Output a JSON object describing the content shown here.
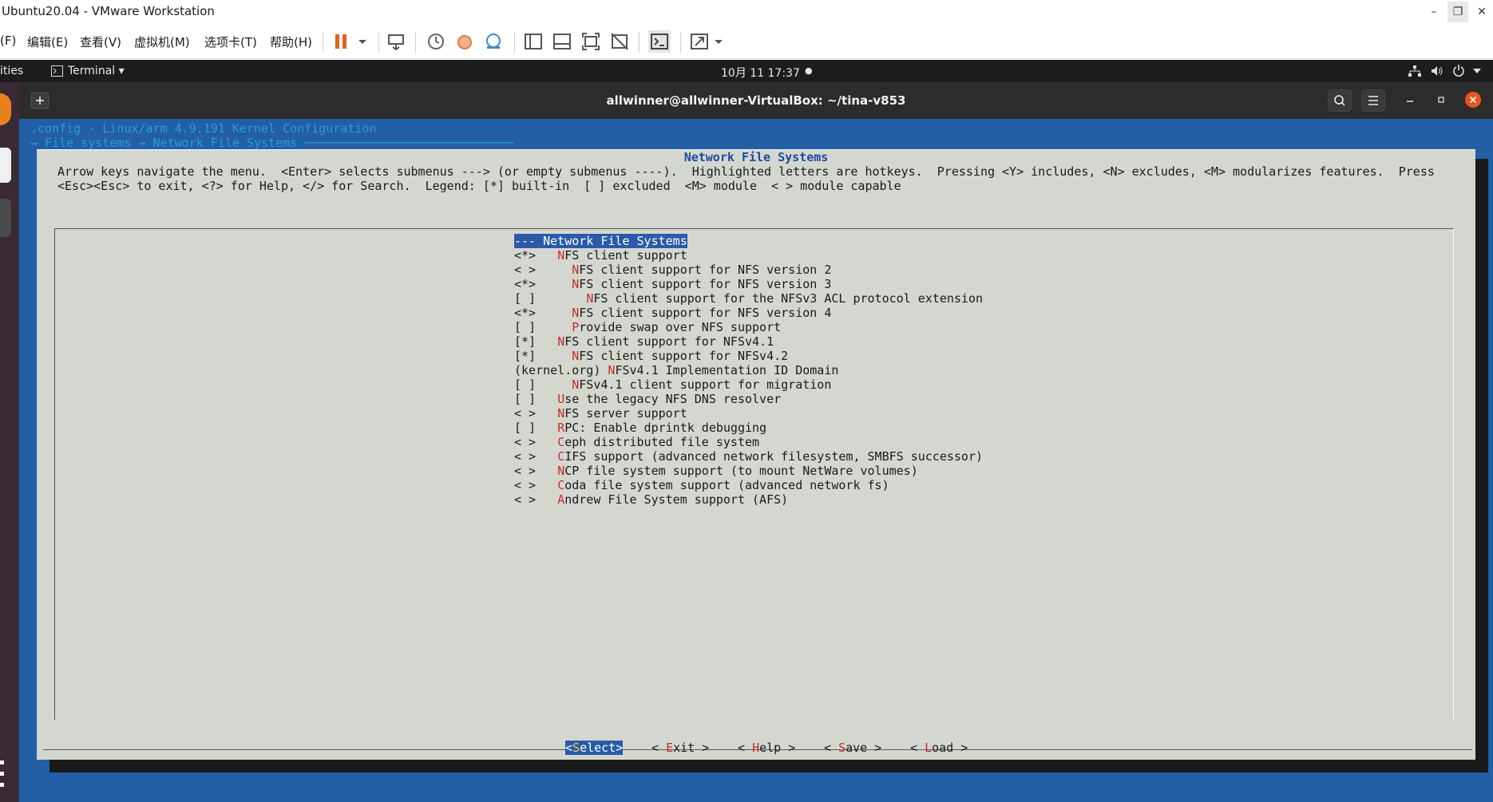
{
  "window": {
    "title": "Ubuntu20.04 - VMware Workstation",
    "controls": [
      "–",
      "❐",
      "✕"
    ]
  },
  "vm_menu": {
    "items": [
      "(F)",
      "编辑(E)",
      "查看(V)",
      "虚拟机(M)",
      "选项卡(T)",
      "帮助(H)"
    ]
  },
  "gnome_bar": {
    "activities": "ities",
    "app": "Terminal ▾",
    "clock": "10月 11  17:37",
    "status_icons": [
      "network-icon",
      "volume-icon",
      "power-icon",
      "caret-icon"
    ]
  },
  "terminal": {
    "title": "allwinner@allwinner-VirtualBox: ~/tina-v853"
  },
  "menuconfig": {
    "config_line": ".config - Linux/arm 4.9.191 Kernel Configuration",
    "breadcrumb": "→ File systems → Network File Systems ─────────────────────────────",
    "dialog_title": "Network File Systems",
    "help_line1": "Arrow keys navigate the menu.  <Enter> selects submenus ---> (or empty submenus ----).  Highlighted letters are hotkeys.  Pressing <Y> includes, <N> excludes, <M> modularizes features.  Press",
    "help_line2": "<Esc><Esc> to exit, <?> for Help, </> for Search.  Legend: [*] built-in  [ ] excluded  <M> module  < > module capable",
    "items": [
      {
        "prefix": "--- ",
        "hot": "",
        "rest": "Network File Systems",
        "selected": true
      },
      {
        "prefix": "<*>   ",
        "hot": "N",
        "rest": "FS client support"
      },
      {
        "prefix": "< >     ",
        "hot": "N",
        "rest": "FS client support for NFS version 2"
      },
      {
        "prefix": "<*>     ",
        "hot": "N",
        "rest": "FS client support for NFS version 3"
      },
      {
        "prefix": "[ ]       ",
        "hot": "N",
        "rest": "FS client support for the NFSv3 ACL protocol extension"
      },
      {
        "prefix": "<*>     ",
        "hot": "N",
        "rest": "FS client support for NFS version 4"
      },
      {
        "prefix": "[ ]     ",
        "hot": "P",
        "rest": "rovide swap over NFS support"
      },
      {
        "prefix": "[*]   ",
        "hot": "N",
        "rest": "FS client support for NFSv4.1"
      },
      {
        "prefix": "[*]     ",
        "hot": "N",
        "rest": "FS client support for NFSv4.2"
      },
      {
        "prefix": "(kernel.org) ",
        "hot": "N",
        "rest": "FSv4.1 Implementation ID Domain"
      },
      {
        "prefix": "[ ]     ",
        "hot": "N",
        "rest": "FSv4.1 client support for migration"
      },
      {
        "prefix": "[ ]   ",
        "hot": "U",
        "rest": "se the legacy NFS DNS resolver"
      },
      {
        "prefix": "< >   ",
        "hot": "N",
        "rest": "FS server support"
      },
      {
        "prefix": "[ ]   ",
        "hot": "R",
        "rest": "PC: Enable dprintk debugging"
      },
      {
        "prefix": "< >   ",
        "hot": "C",
        "rest": "eph distributed file system"
      },
      {
        "prefix": "< >   ",
        "hot": "C",
        "rest": "IFS support (advanced network filesystem, SMBFS successor)"
      },
      {
        "prefix": "< >   ",
        "hot": "N",
        "rest": "CP file system support (to mount NetWare volumes)"
      },
      {
        "prefix": "< >   ",
        "hot": "C",
        "rest": "oda file system support (advanced network fs)"
      },
      {
        "prefix": "< >   ",
        "hot": "A",
        "rest": "ndrew File System support (AFS)"
      }
    ],
    "buttons": {
      "select": {
        "l": "<",
        "hot": "S",
        "rest": "elect>"
      },
      "exit": {
        "l": "< ",
        "hot": "E",
        "rest": "xit >"
      },
      "help": {
        "l": "< ",
        "hot": "H",
        "rest": "elp >"
      },
      "save": {
        "l": "< ",
        "hot": "S",
        "rest": "ave >"
      },
      "load": {
        "l": "< ",
        "hot": "L",
        "rest": "oad >"
      }
    }
  },
  "colors": {
    "terminal_bg": "#225fa6",
    "dialog_bg": "#d4d7d0",
    "hotkey": "#c62b2b",
    "selection": "#2a5aa8",
    "title_blue": "#1d4aa0",
    "header_cyan": "#2f9ad6"
  }
}
